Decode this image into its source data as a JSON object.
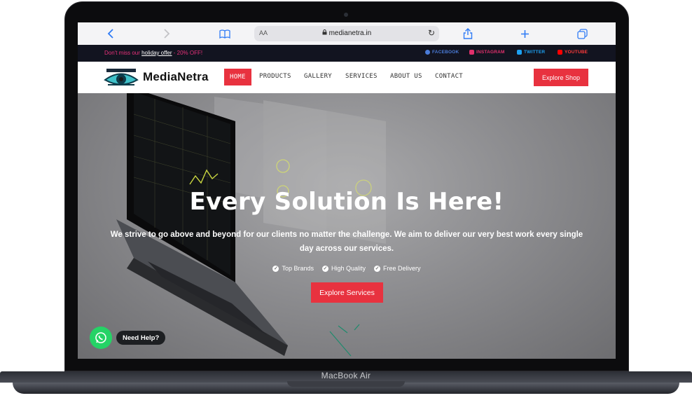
{
  "device": {
    "model_label": "MacBook Air"
  },
  "browser": {
    "url_aa": "AA",
    "url": "medianetra.in",
    "icons": [
      "back-icon",
      "forward-icon",
      "bookmarks-icon",
      "lock-icon",
      "reload-icon",
      "share-icon",
      "new-tab-icon",
      "tabs-icon"
    ]
  },
  "topbar": {
    "promo_prefix": "Don't miss our ",
    "promo_highlight": "holiday offer",
    "promo_suffix": " - 20% OFF!",
    "social": [
      {
        "label": "FACEBOOK",
        "color": "#4a7bd8"
      },
      {
        "label": "INSTAGRAM",
        "color": "#e1306c"
      },
      {
        "label": "TWITTER",
        "color": "#1da1f2"
      },
      {
        "label": "YOUTUBE",
        "color": "#ff0000"
      }
    ]
  },
  "nav": {
    "logo_text": "MediaNetra",
    "items": [
      "HOME",
      "PRODUCTS",
      "GALLERY",
      "SERVICES",
      "ABOUT US",
      "CONTACT"
    ],
    "active": "HOME",
    "cta": "Explore Shop"
  },
  "hero": {
    "title": "Every Solution Is Here!",
    "subtitle": "We strive to go above and beyond for our clients no matter the challenge. We aim to deliver our very best work every single day across our services.",
    "features": [
      "Top Brands",
      "High Quality",
      "Free Delivery"
    ],
    "cta": "Explore Services"
  },
  "help": {
    "label": "Need Help?"
  },
  "colors": {
    "accent": "#e8323f",
    "topbar_bg": "#121420",
    "promo": "#e8317a",
    "whatsapp": "#25d366"
  }
}
